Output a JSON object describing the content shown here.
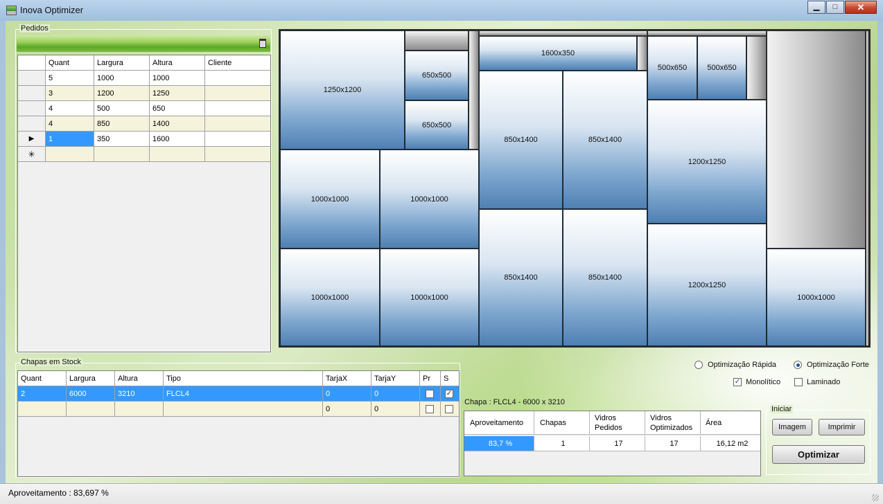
{
  "window": {
    "title": "Inova Optimizer",
    "buttons": {
      "minimize": "▁",
      "maximize": "□",
      "close": "✕"
    }
  },
  "pedidos": {
    "title": "Pedidos",
    "columns": [
      "Quant",
      "Largura",
      "Altura",
      "Cliente"
    ],
    "rows": [
      {
        "quant": "5",
        "largura": "1000",
        "altura": "1000",
        "cliente": ""
      },
      {
        "quant": "3",
        "largura": "1200",
        "altura": "1250",
        "cliente": ""
      },
      {
        "quant": "4",
        "largura": "500",
        "altura": "650",
        "cliente": ""
      },
      {
        "quant": "4",
        "largura": "850",
        "altura": "1400",
        "cliente": ""
      },
      {
        "quant": "1",
        "largura": "350",
        "altura": "1600",
        "cliente": ""
      }
    ],
    "current_row_marker": "▶",
    "new_row_marker": "✳"
  },
  "layout": {
    "pieces": [
      "1250x1200",
      "650x500",
      "650x500",
      "1600x350",
      "500x650",
      "500x650",
      "850x1400",
      "850x1400",
      "1200x1250",
      "1000x1000",
      "1000x1000",
      "1000x1000",
      "1000x1000",
      "850x1400",
      "850x1400",
      "1200x1250",
      "1000x1000"
    ]
  },
  "stock": {
    "title": "Chapas em Stock",
    "columns": [
      "Quant",
      "Largura",
      "Altura",
      "Tipo",
      "TarjaX",
      "TarjaY",
      "Pr",
      "S"
    ],
    "rows": [
      {
        "quant": "2",
        "largura": "6000",
        "altura": "3210",
        "tipo": "FLCL4",
        "tarjax": "0",
        "tarjay": "0",
        "pr": false,
        "s": true
      },
      {
        "quant": "",
        "largura": "",
        "altura": "",
        "tipo": "",
        "tarjax": "0",
        "tarjay": "0",
        "pr": false,
        "s": false
      }
    ]
  },
  "options": {
    "rapida": "Optimização Rápida",
    "forte": "Optimização Forte",
    "monolitico": "Monolítico",
    "laminado": "Laminado",
    "selected": "forte",
    "monolitico_checked": true,
    "laminado_checked": false
  },
  "results": {
    "chapa_label": "Chapa :  FLCL4 - 6000 x 3210",
    "headers": [
      "Aproveitamento",
      "Chapas",
      "Vidros Pedidos",
      "Vidros Optimizados",
      "Área"
    ],
    "values": [
      "83,7 %",
      "1",
      "17",
      "17",
      "16,12 m2"
    ]
  },
  "iniciar": {
    "title": "Iniciar",
    "imagem": "Imagem",
    "imprimir": "Imprimir",
    "optimizar": "Optimizar"
  },
  "status": {
    "text": "Aproveitamento :  83,697  %"
  },
  "colors": {
    "selection": "#3399ff",
    "piece_blue": "#4f80b2",
    "waste_gray": "#8d8d8d"
  }
}
